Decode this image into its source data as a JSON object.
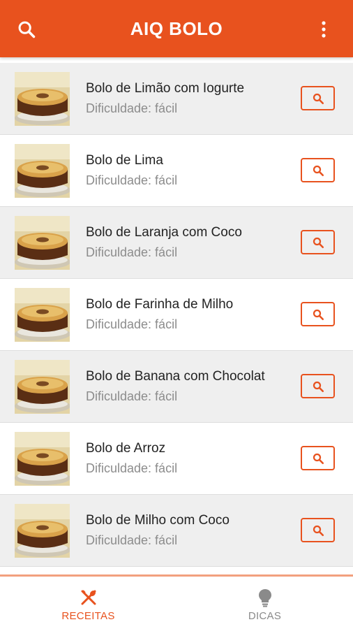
{
  "app": {
    "title": "AIQ BOLO",
    "accent_color": "#e8521e",
    "icons": {
      "search": "search-icon",
      "menu": "more-vert-icon"
    }
  },
  "recipes": [
    {
      "name": "Bolo de Limão com Iogurte",
      "difficulty": "Dificuldade: fácil"
    },
    {
      "name": "Bolo de Lima",
      "difficulty": "Dificuldade: fácil"
    },
    {
      "name": "Bolo de Laranja com Coco",
      "difficulty": "Dificuldade: fácil"
    },
    {
      "name": "Bolo de Farinha de Milho",
      "difficulty": "Dificuldade: fácil"
    },
    {
      "name": "Bolo de Banana com Chocolat",
      "difficulty": "Dificuldade: fácil"
    },
    {
      "name": "Bolo de Arroz",
      "difficulty": "Dificuldade: fácil"
    },
    {
      "name": "Bolo de Milho com Coco",
      "difficulty": "Dificuldade: fácil"
    }
  ],
  "bottom_nav": {
    "tabs": [
      {
        "label": "RECEITAS",
        "icon": "fork-knife-icon",
        "active": true
      },
      {
        "label": "DICAS",
        "icon": "lightbulb-icon",
        "active": false
      }
    ]
  }
}
